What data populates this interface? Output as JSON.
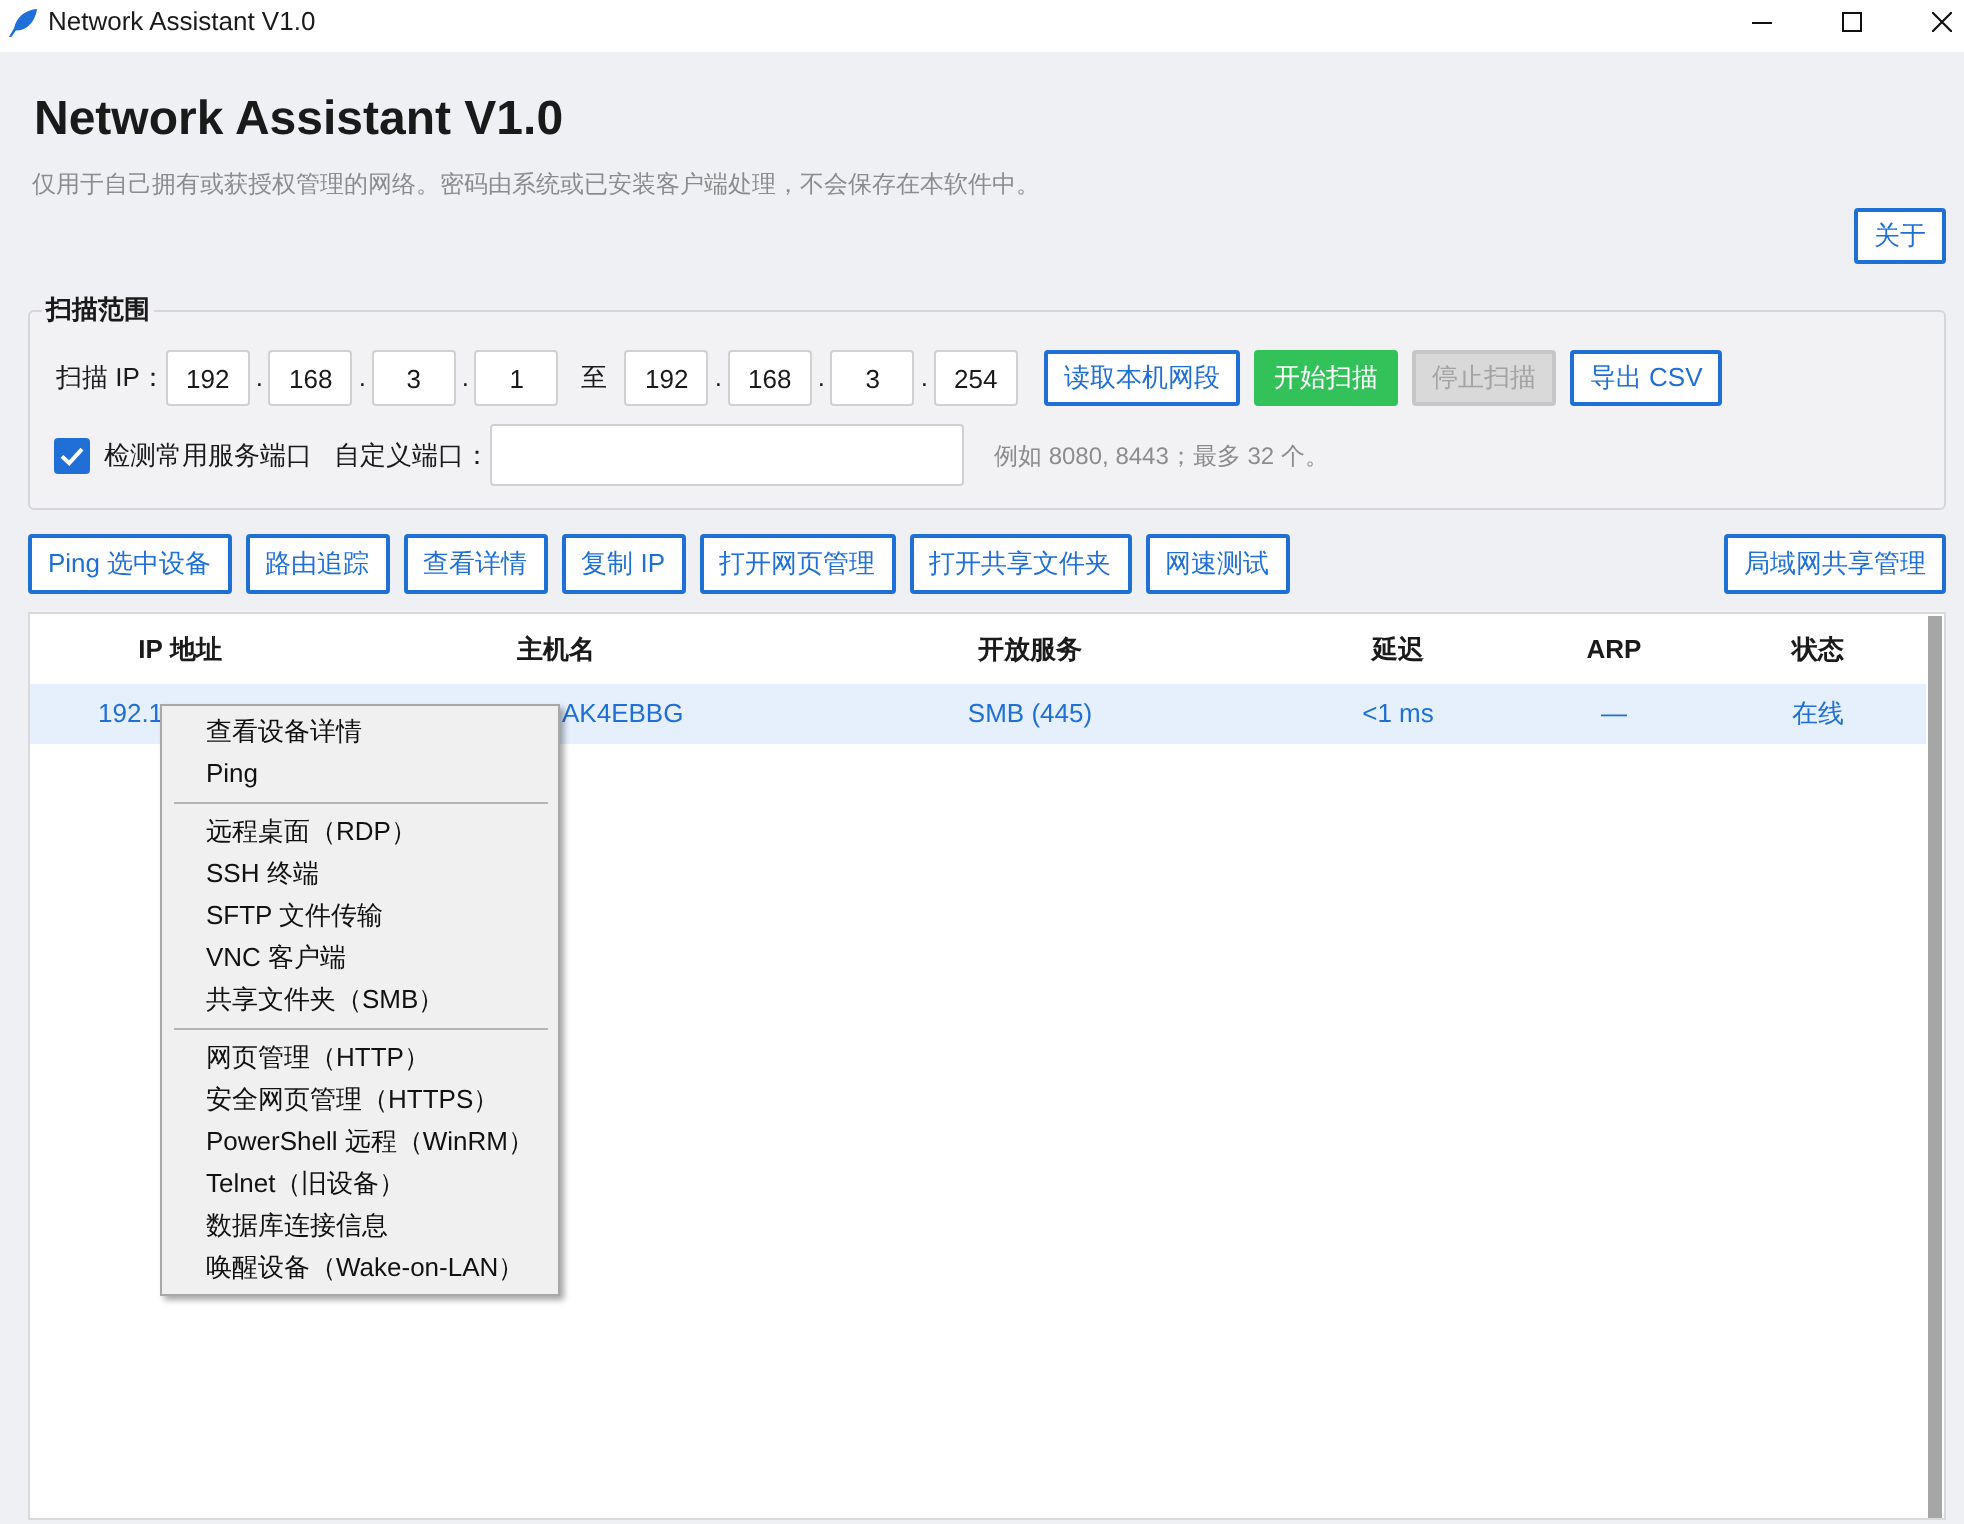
{
  "window": {
    "title": "Network Assistant V1.0"
  },
  "header": {
    "title": "Network Assistant V1.0",
    "subtitle": "仅用于自己拥有或获授权管理的网络。密码由系统或已安装客户端处理，不会保存在本软件中。",
    "about_button": "关于"
  },
  "scan_range": {
    "title": "扫描范围",
    "ip_label": "扫描 IP：",
    "start_ip": {
      "octets": [
        "192",
        "168",
        "3",
        "1"
      ],
      "separators": [
        ".",
        ".",
        "."
      ]
    },
    "range_word": "至",
    "end_ip": {
      "octets": [
        "192",
        "168",
        "3",
        "254"
      ],
      "separators": [
        ".",
        ".",
        "."
      ]
    },
    "buttons": [
      {
        "label": "读取本机网段",
        "kind": "outline",
        "disabled": false
      },
      {
        "label": "开始扫描",
        "kind": "success",
        "disabled": false
      },
      {
        "label": "停止扫描",
        "kind": "outline",
        "disabled": true
      },
      {
        "label": "导出 CSV",
        "kind": "outline",
        "disabled": false
      }
    ],
    "common_ports": {
      "label": "检测常用服务端口",
      "checked": true
    },
    "custom_ports": {
      "label": "自定义端口：",
      "hint": "例如 8080, 8443；最多 32 个。"
    }
  },
  "toolbar": {
    "left_buttons": [
      "Ping 选中设备",
      "路由追踪",
      "查看详情",
      "复制 IP",
      "打开网页管理",
      "打开共享文件夹",
      "网速测试"
    ],
    "right_buttons": [
      "局域网共享管理"
    ]
  },
  "table": {
    "columns": [
      "IP 地址",
      "主机名",
      "开放服务",
      "延迟",
      "ARP",
      "状态"
    ],
    "rows": [
      {
        "selected": true,
        "cells": [
          "192.1",
          "AK4EBBG",
          "SMB (445)",
          "<1 ms",
          "—",
          "在线"
        ]
      }
    ]
  },
  "context_menu": {
    "groups": [
      [
        "查看设备详情",
        "Ping"
      ],
      [
        "远程桌面（RDP）",
        "SSH 终端",
        "SFTP 文件传输",
        "VNC 客户端",
        "共享文件夹（SMB）"
      ],
      [
        "网页管理（HTTP）",
        "安全网页管理（HTTPS）",
        "PowerShell 远程（WinRM）",
        "Telnet（旧设备）",
        "数据库连接信息",
        "唤醒设备（Wake-on-LAN）"
      ]
    ]
  }
}
